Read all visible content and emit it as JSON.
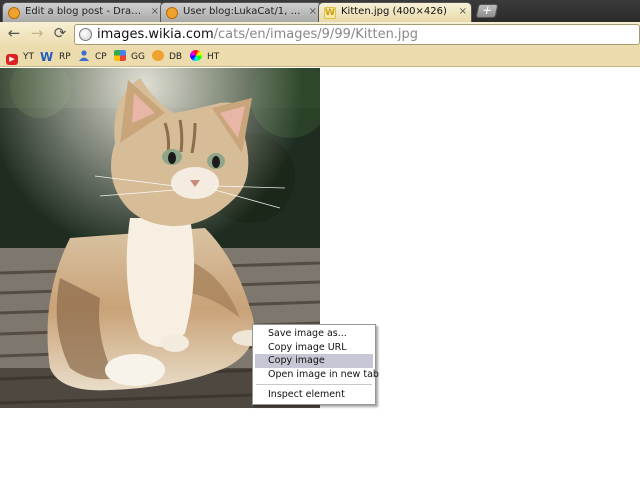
{
  "tabs": [
    {
      "label": "Edit a blog post - Dragon B...",
      "close": "×",
      "favicon": "orange-globe-icon"
    },
    {
      "label": "User blog:LukaCat/1, 2, 3, ...",
      "close": "×",
      "favicon": "orange-globe-icon"
    },
    {
      "label": "Kitten.jpg (400×426)",
      "close": "×",
      "favicon": "wikia-w-icon",
      "active": true
    }
  ],
  "new_tab_label": "+",
  "toolbar": {
    "back": "←",
    "forward": "→",
    "reload": "⟳",
    "url_host": "images.wikia.com",
    "url_path": "/cats/en/images/9/99/Kitten.jpg"
  },
  "bookmarks": [
    {
      "label": "YT",
      "icon": "youtube-icon"
    },
    {
      "label": "RP",
      "icon": "w-icon"
    },
    {
      "label": "CP",
      "icon": "person-icon"
    },
    {
      "label": "GG",
      "icon": "google-icon"
    },
    {
      "label": "DB",
      "icon": "orange-globe-icon"
    },
    {
      "label": "HT",
      "icon": "color-wheel-icon"
    }
  ],
  "image": {
    "description": "kitten-photo",
    "natural_size": "400×426"
  },
  "context_menu": {
    "items": [
      {
        "label": "Save image as..."
      },
      {
        "label": "Copy image URL"
      },
      {
        "label": "Copy image",
        "highlighted": true
      },
      {
        "label": "Open image in new tab"
      }
    ],
    "after_separator": [
      {
        "label": "Inspect element"
      }
    ]
  }
}
